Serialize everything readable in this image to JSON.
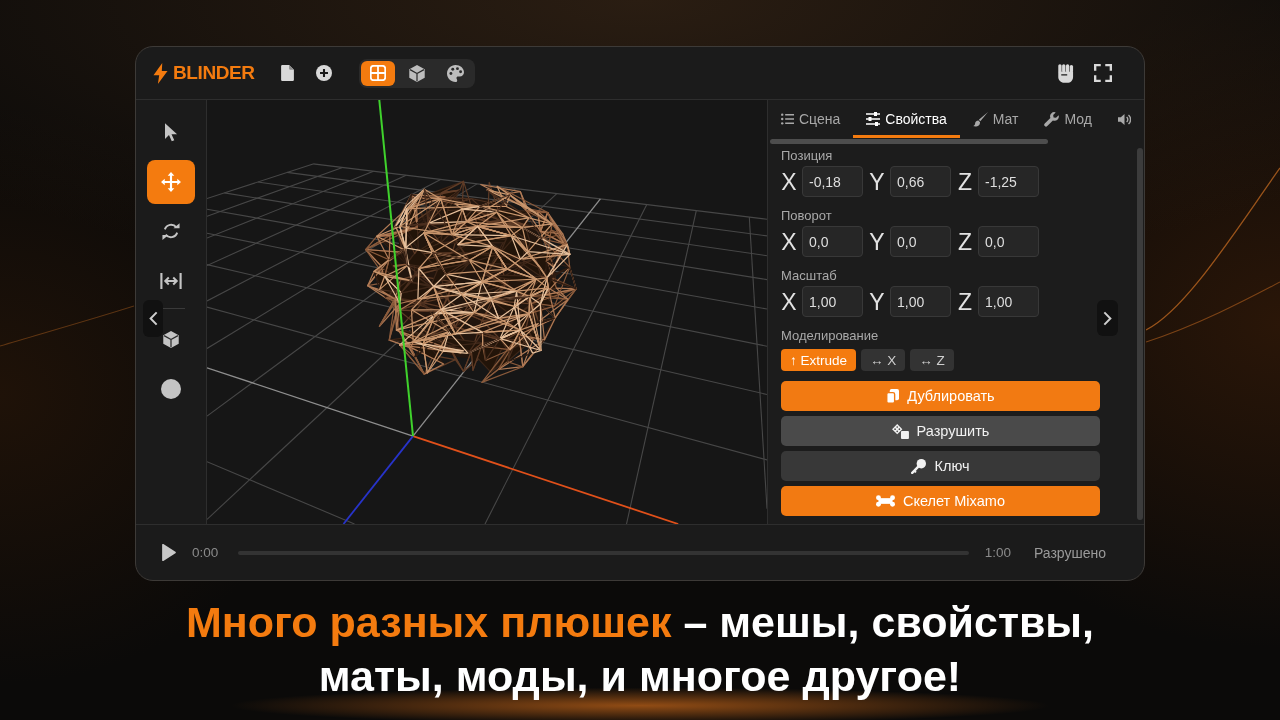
{
  "header": {
    "logo": "BLINDER",
    "view_modes": [
      {
        "selected": true
      },
      {
        "selected": false
      },
      {
        "selected": false
      }
    ]
  },
  "tools": [
    {
      "selected": false
    },
    {
      "selected": true
    },
    {
      "selected": false
    },
    {
      "selected": false
    }
  ],
  "primitives": [
    {
      "selected": false
    },
    {
      "selected": false
    }
  ],
  "panel": {
    "tabs": [
      {
        "label": "Сцена",
        "selected": false
      },
      {
        "label": "Свойства",
        "selected": true
      },
      {
        "label": "Мат",
        "selected": false
      },
      {
        "label": "Мод",
        "selected": false
      },
      {
        "selected": false
      }
    ],
    "sections": [
      {
        "title": "Позиция",
        "fields": [
          {
            "axis": "X",
            "value": "-0,18"
          },
          {
            "axis": "Y",
            "value": "0,66"
          },
          {
            "axis": "Z",
            "value": "-1,25"
          }
        ]
      },
      {
        "title": "Поворот",
        "fields": [
          {
            "axis": "X",
            "value": "0,0"
          },
          {
            "axis": "Y",
            "value": "0,0"
          },
          {
            "axis": "Z",
            "value": "0,0"
          }
        ]
      },
      {
        "title": "Масштаб",
        "fields": [
          {
            "axis": "X",
            "value": "1,00"
          },
          {
            "axis": "Y",
            "value": "1,00"
          },
          {
            "axis": "Z",
            "value": "1,00"
          }
        ]
      }
    ],
    "modeling": {
      "title": "Моделирование",
      "chips": [
        {
          "label": "↑ Extrude",
          "selected": true
        },
        {
          "label": "↔ X",
          "selected": false
        },
        {
          "label": "↔ Z",
          "selected": false
        }
      ]
    },
    "actions": [
      {
        "label": "Дублировать",
        "kind": "accent"
      },
      {
        "label": "Разрушить",
        "kind": "neutral"
      },
      {
        "label": "Ключ",
        "kind": "dark"
      },
      {
        "label": "Скелет Mixamo",
        "kind": "accent"
      }
    ]
  },
  "player": {
    "playing": false,
    "elapsed": "0:00",
    "duration": "1:00",
    "status": "Разрушено"
  },
  "caption": {
    "highlight": "Много разных плюшек",
    "text": "– мешы, свойствы,\nматы, моды, и многое другое!"
  }
}
